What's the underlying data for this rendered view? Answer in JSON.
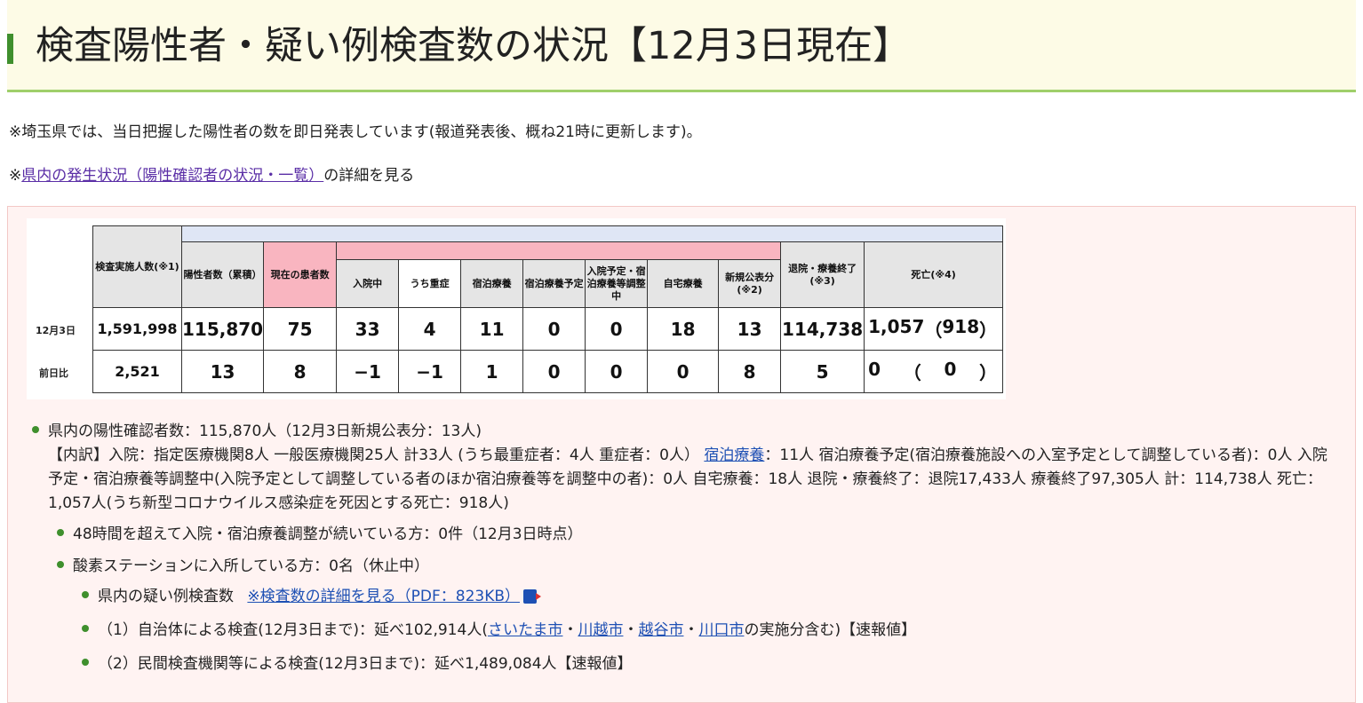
{
  "heading": {
    "title": "検査陽性者・疑い例検査数の状況【12月3日現在】"
  },
  "notes": {
    "line1": "※埼玉県では、当日把握した陽性者の数を即日発表しています(報道発表後、概ね21時に更新します)。",
    "line2_prefix": "※",
    "line2_link": "県内の発生状況（陽性確認者の状況・一覧）",
    "line2_suffix": "の詳細を見る"
  },
  "table": {
    "headers": {
      "tested": "検査実施人数(※1)",
      "positives": "陽性者数（累積）",
      "current": "現在の患者数",
      "hospital": "入院中",
      "severe": "うち重症",
      "hotel": "宿泊療養",
      "hotel_plan": "宿泊療養予定",
      "adjusting": "入院予定・宿泊療養等調整中",
      "home": "自宅療養",
      "new": "新規公表分(※2)",
      "recovered": "退院・療養終了(※3)",
      "deaths": "死亡(※4)"
    },
    "rows": [
      {
        "label": "12月3日",
        "tested": "1,591,998",
        "positives": "115,870",
        "current": "75",
        "hospital": "33",
        "severe": "4",
        "hotel": "11",
        "hotel_plan": "0",
        "adjusting": "0",
        "home": "18",
        "new": "13",
        "recovered": "114,738",
        "deaths": "1,057",
        "deaths_sub": "918"
      },
      {
        "label": "前日比",
        "tested": "2,521",
        "positives": "13",
        "current": "8",
        "hospital": "−1",
        "severe": "−1",
        "hotel": "1",
        "hotel_plan": "0",
        "adjusting": "0",
        "home": "0",
        "new": "8",
        "recovered": "5",
        "deaths": "0",
        "deaths_sub": "0"
      }
    ],
    "paren_open": "（",
    "paren_close": "）"
  },
  "summary": {
    "main": "県内の陽性確認者数：115,870人（12月3日新規公表分：13人)",
    "detail_a": "【内訳】入院：指定医療機関8人 一般医療機関25人 計33人 (うち最重症者：4人 重症者：0人）",
    "detail_link": "宿泊療養",
    "detail_b": "：11人 宿泊療養予定(宿泊療養施設への入室予定として調整している者)：0人 入院予定・宿泊療養等調整中(入院予定として調整している者のほか宿泊療養等を調整中の者)：0人 自宅療養：18人 退院・療養終了：退院17,433人 療養終了97,305人 計：114,738人 死亡：1,057人(うち新型コロナウイルス感染症を死因とする死亡：918人)"
  },
  "bullets": {
    "b48": "48時間を超えて入院・宿泊療養調整が続いている方：0件（12月3日時点）",
    "oxygen": "酸素ステーションに入所している方：0名（休止中）",
    "suspect_prefix": "県内の疑い例検査数",
    "suspect_link": "※検査数の詳細を見る（PDF：823KB）",
    "local_prefix": "（1）自治体による検査(12月3日まで)：延べ102,914人(",
    "city1": "さいたま市",
    "city2": "川越市",
    "city3": "越谷市",
    "city4": "川口市",
    "sep": "・",
    "local_suffix": "の実施分含む)【速報値】",
    "private": "（2）民間検査機関等による検査(12月3日まで)：延べ1,489,084人【速報値】"
  },
  "colors": {
    "accent_green": "#3f8f2d",
    "link_blue": "#1e50b4",
    "link_visited": "#5a2ea6",
    "panel_bg": "#fff3f2"
  }
}
